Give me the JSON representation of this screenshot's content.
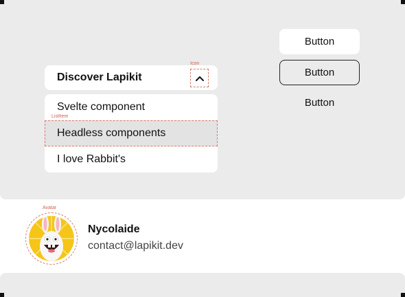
{
  "accordion": {
    "title": "Discover Lapikit",
    "icon_annotation": "Icon",
    "icon": "chevron-up-icon"
  },
  "list": {
    "annotation": "ListItem",
    "items": [
      "Svelte component",
      "Headless components",
      "I love Rabbit's"
    ]
  },
  "buttons": {
    "filled_label": "Button",
    "outlined_label": "Button",
    "text_label": "Button"
  },
  "profile": {
    "avatar_annotation": "Avatar",
    "avatar": "rabbid-avatar",
    "name": "Nycolaide",
    "email": "contact@lapikit.dev"
  },
  "colors": {
    "panel": "#ebebeb",
    "surface": "#ffffff",
    "annotation": "#d06050",
    "selected": "#e3e3e3",
    "avatar_bg": "#f5c518"
  }
}
